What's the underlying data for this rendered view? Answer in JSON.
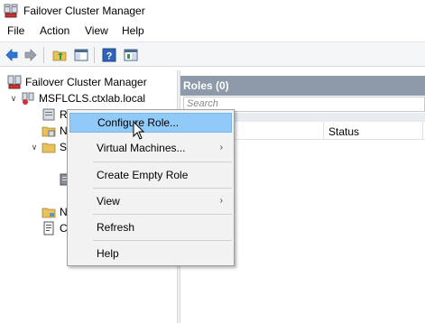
{
  "window": {
    "title": "Failover Cluster Manager",
    "icon": "failover-cluster-manager-icon"
  },
  "menubar": [
    {
      "label": "File"
    },
    {
      "label": "Action"
    },
    {
      "label": "View"
    },
    {
      "label": "Help"
    }
  ],
  "toolbar": {
    "buttons": [
      {
        "icon": "back-arrow-icon"
      },
      {
        "icon": "forward-arrow-icon"
      },
      {
        "icon": "up-folder-icon"
      },
      {
        "icon": "show-hide-console-tree-icon"
      },
      {
        "icon": "help-icon"
      },
      {
        "icon": "show-hide-action-pane-icon"
      }
    ]
  },
  "tree": {
    "root_label": "Failover Cluster Manager",
    "cluster_label": "MSFLCLS.ctxlab.local",
    "children_truncated": [
      {
        "label": "R"
      },
      {
        "label": "N"
      },
      {
        "label": "S"
      },
      {
        "label": ""
      },
      {
        "label": ""
      },
      {
        "label": "N"
      },
      {
        "label": "C"
      }
    ]
  },
  "content": {
    "header": "Roles (0)",
    "search_placeholder": "Search",
    "columns": [
      {
        "label": "Status"
      }
    ]
  },
  "context_menu": {
    "items": [
      {
        "label": "Configure Role...",
        "highlighted": true,
        "submenu": false
      },
      {
        "label": "Virtual Machines...",
        "highlighted": false,
        "submenu": true
      },
      {
        "label": "Create Empty Role",
        "highlighted": false,
        "submenu": false
      },
      {
        "label": "View",
        "highlighted": false,
        "submenu": true
      },
      {
        "label": "Refresh",
        "highlighted": false,
        "submenu": false
      },
      {
        "label": "Help",
        "highlighted": false,
        "submenu": false
      }
    ],
    "submenu_arrow": "›"
  },
  "colors": {
    "header_bar": "#8e9aa9",
    "highlight": "#91c9f7",
    "highlight_border": "#7eb4ea",
    "menu_bg": "#f2f2f2"
  }
}
